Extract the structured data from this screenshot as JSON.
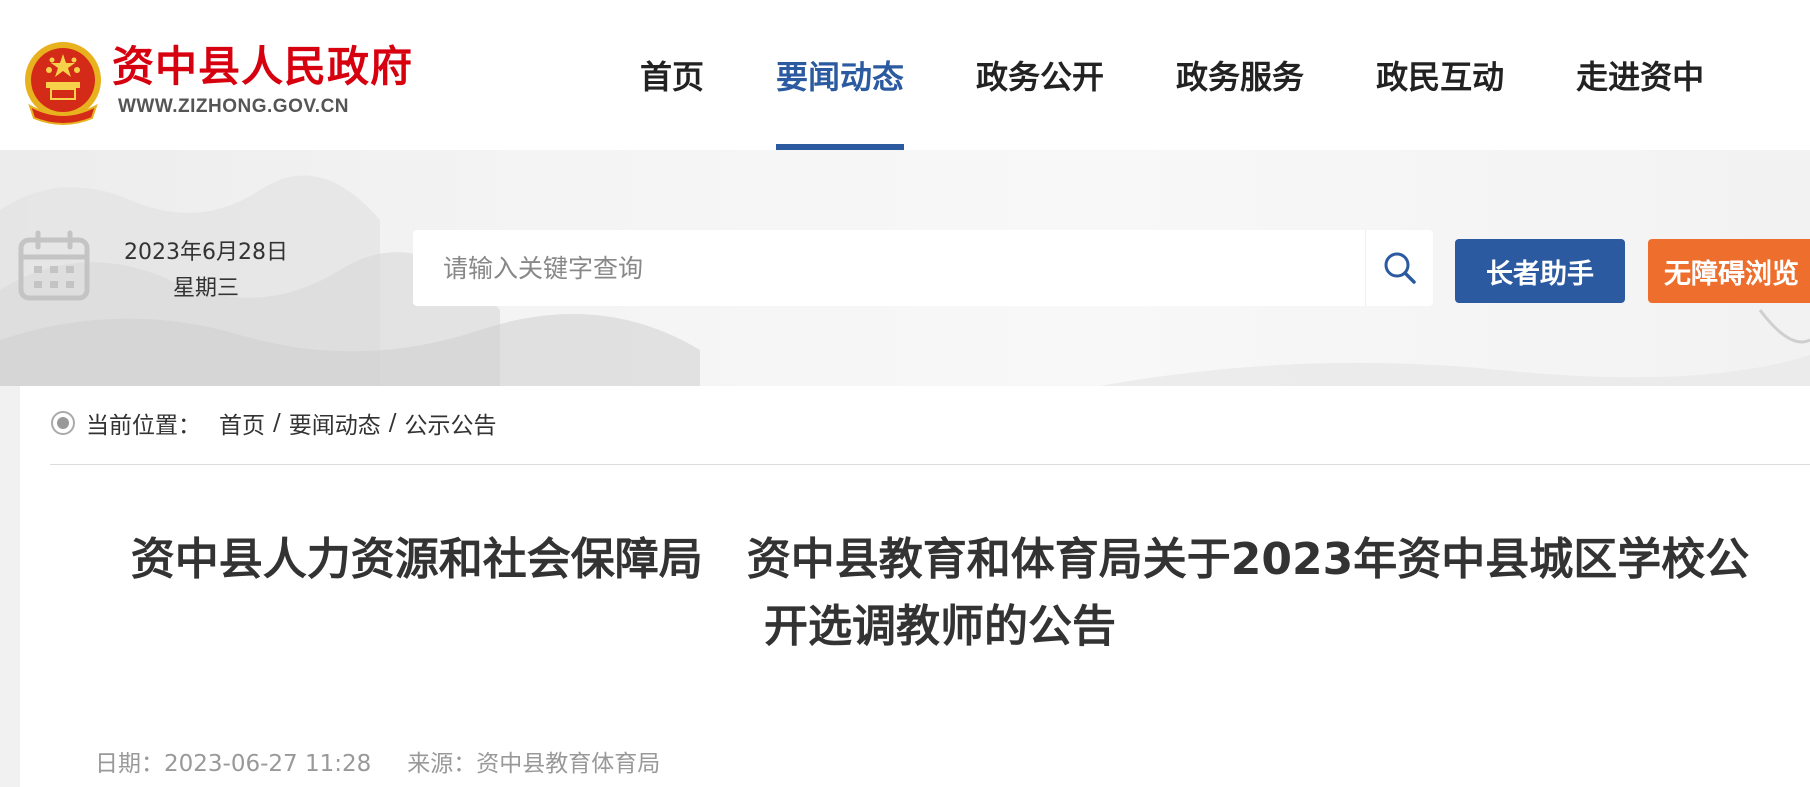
{
  "header": {
    "site_name": "资中县人民政府",
    "site_domain": "WWW.ZIZHONG.GOV.CN",
    "nav": [
      {
        "label": "首页"
      },
      {
        "label": "要闻动态",
        "active": true
      },
      {
        "label": "政务公开"
      },
      {
        "label": "政务服务"
      },
      {
        "label": "政民互动"
      },
      {
        "label": "走进资中"
      }
    ]
  },
  "toolbar": {
    "date": "2023年6月28日",
    "weekday": "星期三",
    "search_placeholder": "请输入关键字查询",
    "elder_label": "长者助手",
    "accessible_label": "无障碍浏览"
  },
  "breadcrumb": {
    "label": "当前位置：",
    "items": [
      "首页",
      "要闻动态",
      "公示公告"
    ],
    "separator": "/"
  },
  "article": {
    "title": "资中县人力资源和社会保障局　资中县教育和体育局关于2023年资中县城区学校公开选调教师的公告",
    "date_label": "日期：2023-06-27 11:28",
    "source_label": "来源：资中县教育体育局"
  },
  "colors": {
    "brand_red": "#d7000f",
    "accent_blue": "#2c5aa0",
    "accessible_orange": "#ee6f2d"
  },
  "icons": [
    "national-emblem-icon",
    "calendar-icon",
    "search-icon",
    "location-dot-icon"
  ]
}
